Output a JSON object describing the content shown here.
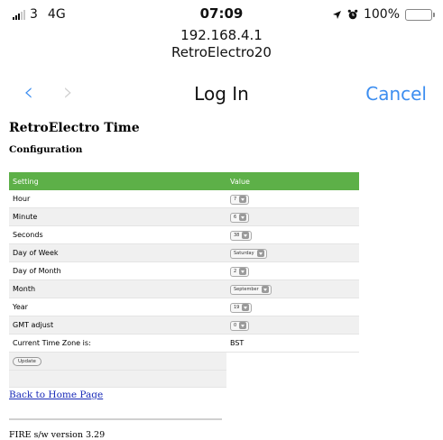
{
  "status_bar": {
    "carrier": "3",
    "network": "4G",
    "time": "07:09",
    "battery": "100%"
  },
  "address": {
    "host": "192.168.4.1",
    "site": "RetroElectro20"
  },
  "nav": {
    "back": "‹",
    "forward": "›",
    "title": "Log In",
    "cancel": "Cancel"
  },
  "page": {
    "title": "RetroElectro Time",
    "subtitle": "Configuration",
    "table": {
      "headers": [
        "Setting",
        "Value"
      ],
      "rows": [
        {
          "setting": "Hour",
          "value": "7"
        },
        {
          "setting": "Minute",
          "value": "6"
        },
        {
          "setting": "Seconds",
          "value": "38"
        },
        {
          "setting": "Day of Week",
          "value": "Saturday"
        },
        {
          "setting": "Day of Month",
          "value": "2"
        },
        {
          "setting": "Month",
          "value": "September"
        },
        {
          "setting": "Year",
          "value": "19"
        },
        {
          "setting": "GMT adjust",
          "value": "0"
        },
        {
          "setting": "Current Time Zone is:",
          "value": "BST"
        }
      ],
      "update_button": "Update"
    },
    "back_link": "Back to Home Page",
    "version": "FIRE s/w version 3.29"
  }
}
